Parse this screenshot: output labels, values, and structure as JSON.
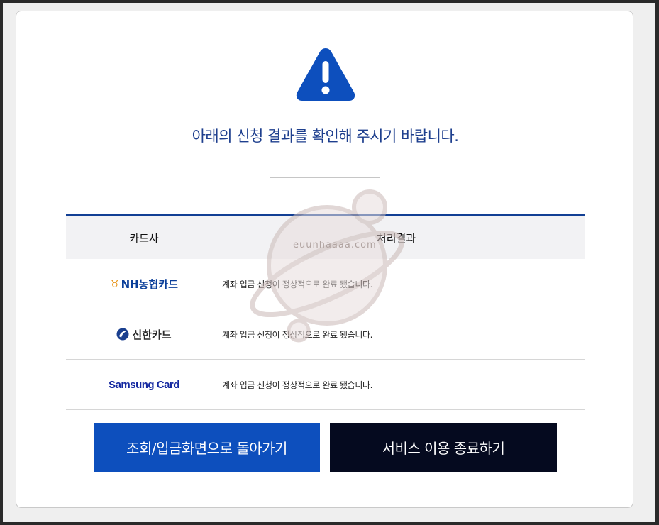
{
  "headline": "아래의 신청 결과를 확인해 주시기 바랍니다.",
  "table": {
    "col_card": "카드사",
    "col_result": "처리결과",
    "rows": [
      {
        "brand": "NH농협카드",
        "message": "계좌 입금 신청이 정상적으로 완료 됐습니다."
      },
      {
        "brand": "신한카드",
        "message": "계좌 입금 신청이 정상적으로 완료 됐습니다."
      },
      {
        "brand": "Samsung Card",
        "message": "계좌 입금 신청이 정상적으로 완료 됐습니다."
      }
    ]
  },
  "buttons": {
    "back": "조회/입금화면으로 돌아가기",
    "exit": "서비스 이용 종료하기"
  },
  "watermark": "euunhaaaa.com",
  "icons": {
    "alert": "warning-triangle-icon",
    "nh": "nh-logo-icon",
    "shinhan": "shinhan-logo-icon"
  },
  "colors": {
    "accent": "#0d4fbd",
    "headline": "#1e3f8e",
    "table_border": "#123f94",
    "exit_button": "#050a1f"
  }
}
